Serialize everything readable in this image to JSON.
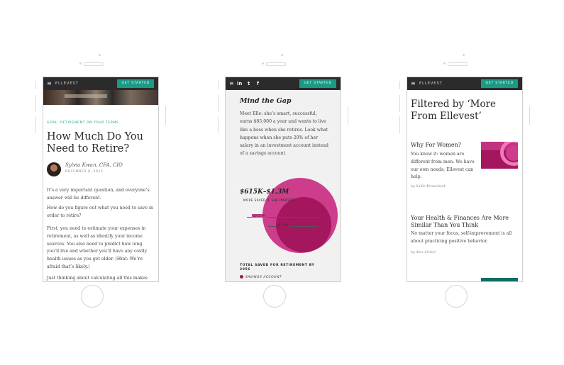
{
  "phone1": {
    "menu_glyph": "≡",
    "brand": "ELLEVEST",
    "cta": "GET STARTED",
    "eyebrow": "GOAL: RETIREMENT ON YOUR TERMS",
    "title": "How Much Do You Need to Retire?",
    "author": "Sylvia Kwan, CFA, CIO",
    "date": "DECEMBER 8, 2015",
    "paragraphs": [
      "It’s a very important question, and everyone’s answer will be different.",
      "How do you figure out what you need to save in order to retire?",
      "First, you need to estimate your expenses in retirement, as well as identify your income sources. You also need to predict how long you’ll live and whether you’ll have any costly health issues as you get older. (Hint: We’re afraid that’s likely.)",
      "Just thinking about calculating all this makes me"
    ]
  },
  "phone2": {
    "menu_glyph": "≡",
    "social": [
      "in",
      "t",
      "f"
    ],
    "social_icons": [
      "linkedin-icon",
      "twitter-icon",
      "facebook-icon"
    ],
    "cta": "GET STARTED",
    "heading": "Mind the Gap",
    "body": "Meet Elle: she’s smart, successful, earns $85,000 a year and wants to live like a boss when she retires. Look what happens when she puts 20% of her salary in an investment account instead of a savings account.",
    "range": "$615K–$1.3M",
    "range_caption": "MORE SAVED IF SHE INVESTS",
    "label_a": "$2–2.7M",
    "label_b": "$1.39M",
    "total_label": "TOTAL SAVED FOR RETIREMENT BY 2056",
    "legend": "SAVINGS ACCOUNT",
    "colors": {
      "investing": "#cd3d8b",
      "savings": "#a4175f"
    }
  },
  "phone3": {
    "menu_glyph": "≡",
    "brand": "ELLEVEST",
    "cta": "GET STARTED",
    "title": "Filtered by ‘More From Ellevest’",
    "cards": [
      {
        "title": "Why For Women?",
        "text": "You know it: women are different from men. We have our own needs; Ellevest can help.",
        "byline": "by Sallie Krawcheck"
      },
      {
        "title": "Your Health & Finances Are More Similar Than You Think",
        "text": "No matter your focus, self-improvement is all about practicing positive behavior.",
        "byline": "by Alex Sirisel"
      }
    ]
  },
  "accent_color": "#1d9a86",
  "nav_color": "#2b2b2b"
}
